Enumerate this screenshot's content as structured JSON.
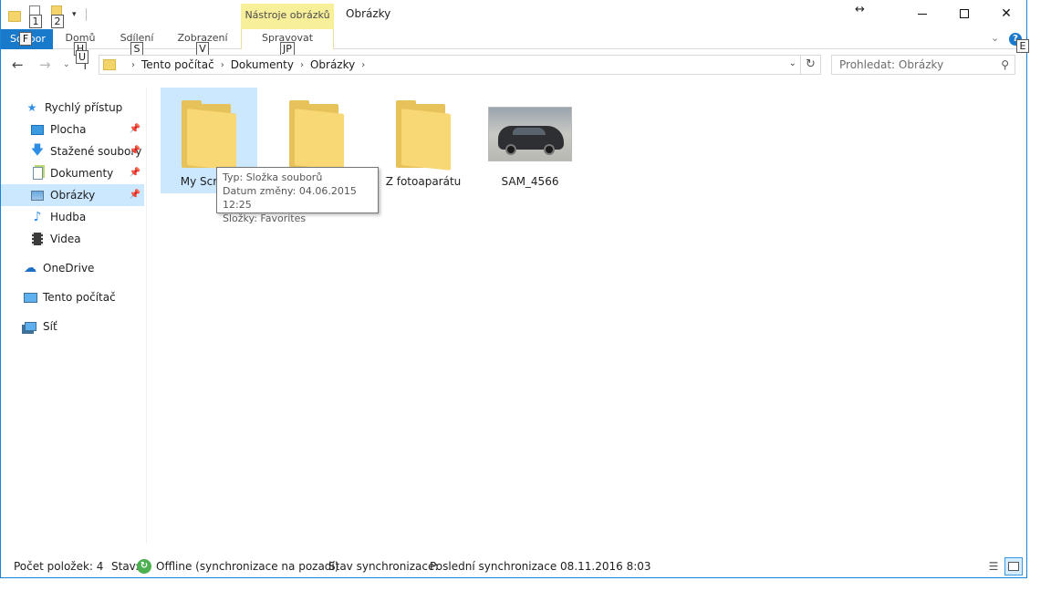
{
  "titlebar": {
    "qat_keytips": [
      "1",
      "2"
    ],
    "context_tab": "Nástroje obrázků",
    "title": "Obrázky"
  },
  "ribbon": {
    "file_tab": "Soubor",
    "file_keytip": "F",
    "tabs": [
      {
        "label": "Domů",
        "keytip": "H"
      },
      {
        "label": "Sdílení",
        "keytip": "S"
      },
      {
        "label": "Zobrazení",
        "keytip": "V"
      },
      {
        "label": "Spravovat",
        "keytip": "JP"
      }
    ],
    "help_keytip": "E"
  },
  "address": {
    "up_keytip": "U",
    "crumbs": [
      "Tento počítač",
      "Dokumenty",
      "Obrázky"
    ],
    "search_placeholder": "Prohledat: Obrázky"
  },
  "nav": {
    "items": [
      {
        "label": "Rychlý přístup",
        "icon": "star-icon",
        "pinned": false
      },
      {
        "label": "Plocha",
        "icon": "desktop-icon",
        "pinned": true
      },
      {
        "label": "Stažené soubory",
        "icon": "download-icon",
        "pinned": true
      },
      {
        "label": "Dokumenty",
        "icon": "documents-icon",
        "pinned": true
      },
      {
        "label": "Obrázky",
        "icon": "pictures-icon",
        "pinned": true,
        "selected": true
      },
      {
        "label": "Hudba",
        "icon": "music-icon",
        "pinned": false
      },
      {
        "label": "Videa",
        "icon": "video-icon",
        "pinned": false
      },
      {
        "label": "OneDrive",
        "icon": "cloud-icon",
        "pinned": false
      },
      {
        "label": "Tento počítač",
        "icon": "computer-icon",
        "pinned": false
      },
      {
        "label": "Síť",
        "icon": "network-icon",
        "pinned": false
      }
    ]
  },
  "content": {
    "items": [
      {
        "label": "My Screen",
        "kind": "folder-with-files",
        "selected": true
      },
      {
        "label": "",
        "kind": "folder"
      },
      {
        "label": "Z fotoaparátu",
        "kind": "folder"
      },
      {
        "label": "SAM_4566",
        "kind": "photo"
      }
    ]
  },
  "tooltip": {
    "line1": "Typ: Složka souborů",
    "line2": "Datum změny: 04.06.2015 12:25",
    "line3": "Složky: Favorites"
  },
  "status": {
    "count": "Počet položek: 4",
    "state_label": "Stav:",
    "state_value": "Offline (synchronizace na pozadí)",
    "sync_label": "Stav synchronizace:",
    "sync_value": "Poslední synchronizace 08.11.2016 8:03"
  },
  "colors": {
    "accent": "#1979ca",
    "selection": "#cce8ff",
    "context_tab": "#f7ef9a",
    "folder": "#f8d775"
  }
}
